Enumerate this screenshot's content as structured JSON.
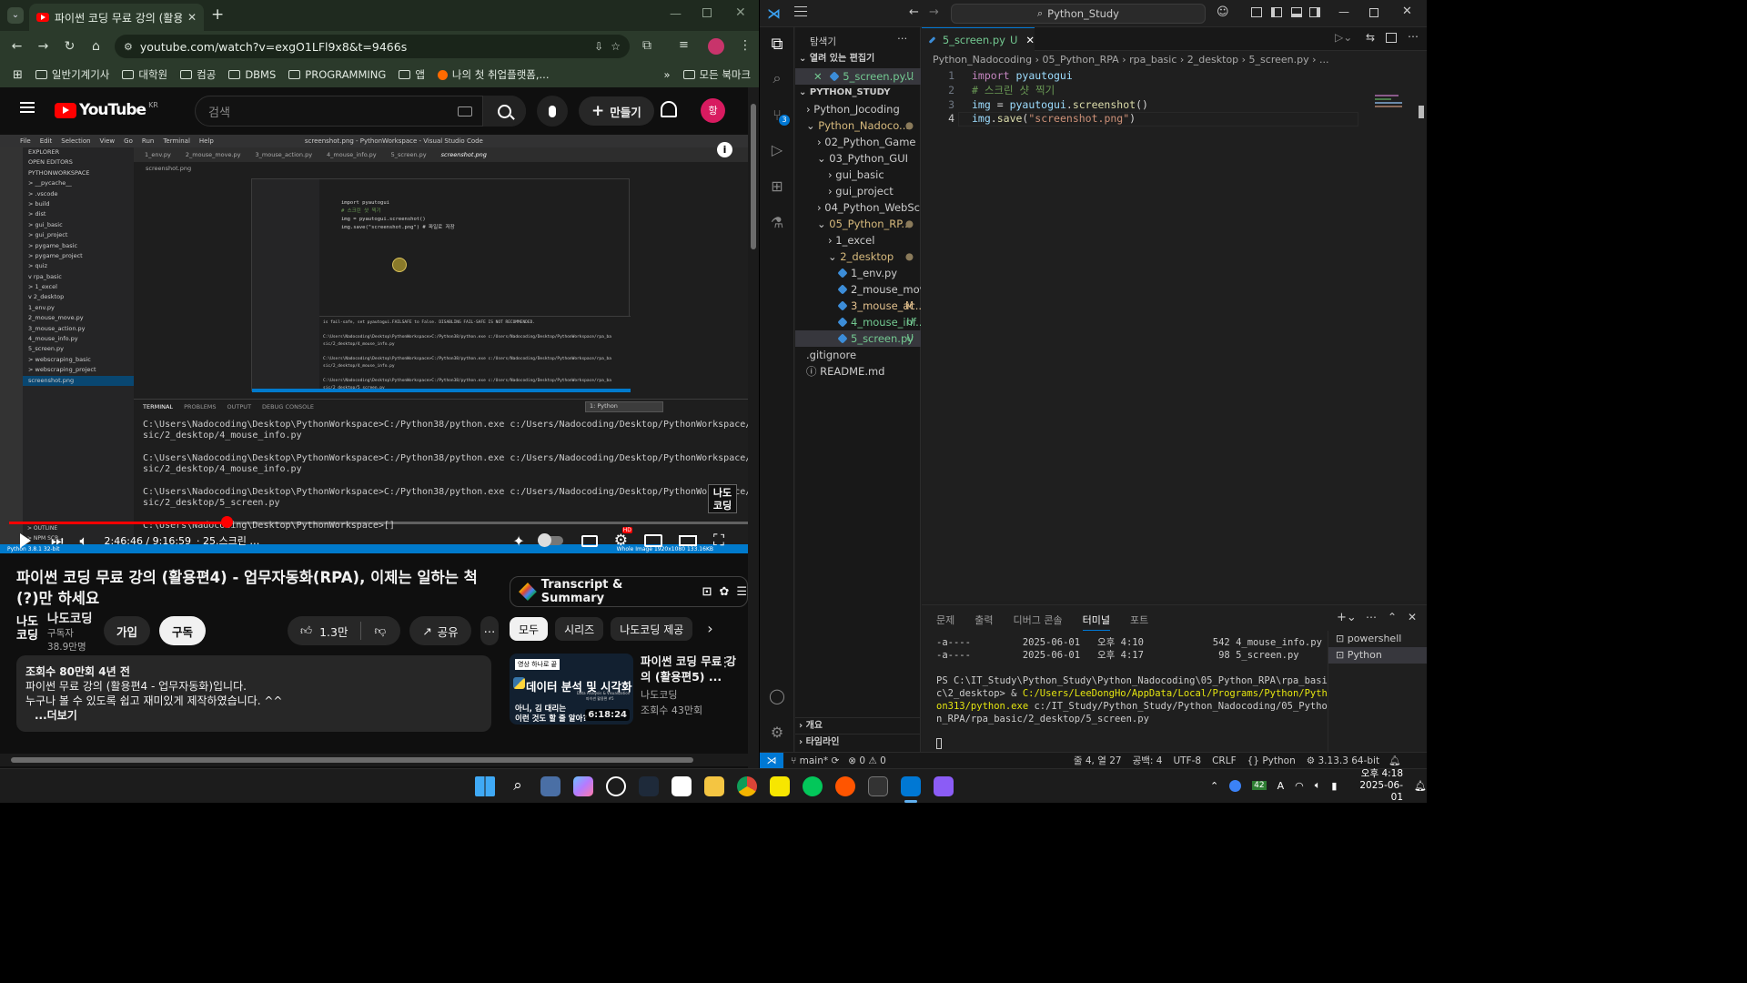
{
  "chrome": {
    "tab_title": "파이썬 코딩 무료 강의 (활용편",
    "url": "youtube.com/watch?v=exgO1LFl9x8&t=9466s",
    "bookmarks": [
      "일반기계기사",
      "대학원",
      "컴공",
      "DBMS",
      "PROGRAMMING",
      "앱",
      "나의 첫 취업플랫폼,..."
    ],
    "all_bookmarks": "모든 북마크"
  },
  "youtube": {
    "logo": "YouTube",
    "country": "KR",
    "search_placeholder": "검색",
    "create_label": "만들기",
    "avatar_initial": "항",
    "video": {
      "time": "2:46:46 / 9:16:59",
      "chapter": "· 25.스크린 …",
      "progress": 0.3,
      "watermark": "나도\n코딩",
      "hd_badge": "HD"
    },
    "title": "파이썬 코딩 무료 강의 (활용편4) - 업무자동화(RPA), 이제는 일하는 척(?)만 하세요",
    "channel_name": "나도코딩",
    "subscribers": "구독자 38.9만명",
    "channel_logo": "나도\n코딩",
    "join_label": "가입",
    "subscribe_label": "구독",
    "likes": "1.3만",
    "share_label": "공유",
    "description": {
      "stats": "조회수 80만회  4년 전",
      "line1": "파이썬 무료 강의 (활용편4 - 업무자동화)입니다.",
      "line2": "누구나 볼 수 있도록 쉽고 재미있게 제작하였습니다. ^^",
      "more": "...더보기"
    },
    "transcript_label": "Transcript & Summary",
    "chips": [
      "모두",
      "시리즈",
      "나도코딩 제공"
    ],
    "recommendation": {
      "thumb_badge": "영상 하나로 끝",
      "thumb_title": "데이터 분석 및 시각화",
      "thumb_sub1": "아니, 김 대리는",
      "thumb_sub2": "이런 것도 할 줄 알아?",
      "thumb_caption": "Data Analysis & Visualization",
      "thumb_caption2": "파이썬 활용편 #5",
      "duration": "6:18:24",
      "title": "파이썬 코딩 무료 강의 (활용편5) ...",
      "channel": "나도코딩",
      "views": "조회수 43만회"
    }
  },
  "video_frame": {
    "menu": [
      "File",
      "Edit",
      "Selection",
      "View",
      "Go",
      "Run",
      "Terminal",
      "Help"
    ],
    "window_title": "screenshot.png - PythonWorkspace - Visual Studio Code",
    "tabs": [
      "1_env.py",
      "2_mouse_move.py",
      "3_mouse_action.py",
      "4_mouse_info.py",
      "5_screen.py",
      "screenshot.png"
    ],
    "sidebar": [
      "EXPLORER",
      "OPEN EDITORS",
      "PYTHONWORKSPACE",
      "> __pycache__",
      "> .vscode",
      "> build",
      "> dist",
      "> gui_basic",
      "> gui_project",
      "> pygame_basic",
      "> pygame_project",
      "> quiz",
      "v rpa_basic",
      "  > 1_excel",
      "  v 2_desktop",
      "    1_env.py",
      "    2_mouse_move.py",
      "    3_mouse_action.py",
      "    4_mouse_info.py",
      "    5_screen.py",
      "> webscraping_basic",
      "> webscraping_project",
      "screenshot.png"
    ],
    "inner_code": [
      "import pyautogui",
      "# 스크린 샷 찍기",
      "img = pyautogui.screenshot()",
      "img.save(\"screenshot.png\") # 파일로 저장"
    ],
    "terminal_tabs": [
      "TERMINAL",
      "PROBLEMS",
      "OUTPUT",
      "DEBUG CONSOLE"
    ],
    "terminal_select": "1: Python",
    "terminal_lines": "C:\\Users\\Nadocoding\\Desktop\\PythonWorkspace>C:/Python38/python.exe c:/Users/Nadocoding/Desktop/PythonWorkspace/rpa_ba\nsic/2_desktop/4_mouse_info.py\n\nC:\\Users\\Nadocoding\\Desktop\\PythonWorkspace>C:/Python38/python.exe c:/Users/Nadocoding/Desktop/PythonWorkspace/rpa_ba\nsic/2_desktop/4_mouse_info.py\n\nC:\\Users\\Nadocoding\\Desktop\\PythonWorkspace>C:/Python38/python.exe c:/Users/Nadocoding/Desktop/PythonWorkspace/rpa_ba\nsic/2_desktop/5_screen.py\n\nC:\\Users\\Nadocoding\\Desktop\\PythonWorkspace>[]",
    "inner_terminal": "is fail-safe, set pyautogui.FAILSAFE to False. DISABLING FAIL-SAFE IS NOT RECOMMENDED.\n\nC:\\Users\\Nadocoding\\Desktop\\PythonWorkspace>C:/Python38/python.exe c:/Users/Nadocoding/Desktop/PythonWorkspace/rpa_ba\nsic/2_desktop/4_mouse_info.py\n\nC:\\Users\\Nadocoding\\Desktop\\PythonWorkspace>C:/Python38/python.exe c:/Users/Nadocoding/Desktop/PythonWorkspace/rpa_ba\nsic/2_desktop/4_mouse_info.py\n\nC:\\Users\\Nadocoding\\Desktop\\PythonWorkspace>C:/Python38/python.exe c:/Users/Nadocoding/Desktop/PythonWorkspace/rpa_ba\nsic/2_desktop/5_screen.py",
    "outline": "> OUTLINE",
    "npm": "> NPM SCR...",
    "status_left": "Python 3.8.1 32-bit",
    "status_right": "Whole Image   1920x1080   133.16KB"
  },
  "vscode": {
    "command_center": "Python_Study",
    "explorer_title": "탐색기",
    "open_editors_label": "열려 있는 편집기",
    "open_editor_file": "5_screen.py...",
    "open_editor_badge": "U",
    "workspace_label": "PYTHON_STUDY",
    "tree": [
      {
        "label": "Python_Jocoding",
        "indent": 1,
        "kind": "folder-closed",
        "badge": "",
        "color": "#cccccc"
      },
      {
        "label": "Python_Nadoco...",
        "indent": 1,
        "kind": "folder-open",
        "badge": "●",
        "color": "#d7ba7d"
      },
      {
        "label": "02_Python_Game",
        "indent": 2,
        "kind": "folder-closed",
        "badge": "",
        "color": "#cccccc"
      },
      {
        "label": "03_Python_GUI",
        "indent": 2,
        "kind": "folder-open",
        "badge": "",
        "color": "#cccccc"
      },
      {
        "label": "gui_basic",
        "indent": 3,
        "kind": "folder-closed",
        "badge": "",
        "color": "#cccccc"
      },
      {
        "label": "gui_project",
        "indent": 3,
        "kind": "folder-closed",
        "badge": "",
        "color": "#cccccc"
      },
      {
        "label": "04_Python_WebScra...",
        "indent": 2,
        "kind": "folder-closed",
        "badge": "",
        "color": "#cccccc"
      },
      {
        "label": "05_Python_RP...",
        "indent": 2,
        "kind": "folder-open",
        "badge": "●",
        "color": "#d7ba7d"
      },
      {
        "label": "1_excel",
        "indent": 3,
        "kind": "folder-closed",
        "badge": "",
        "color": "#cccccc"
      },
      {
        "label": "2_desktop",
        "indent": 3,
        "kind": "folder-open",
        "badge": "●",
        "color": "#d7ba7d"
      },
      {
        "label": "1_env.py",
        "indent": 4,
        "kind": "py",
        "badge": "",
        "color": "#cccccc"
      },
      {
        "label": "2_mouse_move.py",
        "indent": 4,
        "kind": "py",
        "badge": "",
        "color": "#cccccc"
      },
      {
        "label": "3_mouse_ac...",
        "indent": 4,
        "kind": "py",
        "badge": "M",
        "color": "#e2c08d"
      },
      {
        "label": "4_mouse_inf...",
        "indent": 4,
        "kind": "py",
        "badge": "U",
        "color": "#73c991"
      },
      {
        "label": "5_screen.py",
        "indent": 4,
        "kind": "py",
        "badge": "U",
        "color": "#73c991"
      },
      {
        "label": ".gitignore",
        "indent": 1,
        "kind": "file",
        "badge": "",
        "color": "#cccccc"
      },
      {
        "label": "README.md",
        "indent": 1,
        "kind": "info",
        "badge": "",
        "color": "#cccccc"
      }
    ],
    "outline_label": "개요",
    "timeline_label": "타임라인",
    "tab_label": "5_screen.py",
    "tab_badge": "U",
    "breadcrumb": "Python_Nadocoding › 05_Python_RPA › rpa_basic › 2_desktop › 5_screen.py › ...",
    "code_lines": [
      [
        {
          "t": "import ",
          "c": "kw"
        },
        {
          "t": "pyautogui",
          "c": "var"
        }
      ],
      [
        {
          "t": "# 스크린 샷 찍기",
          "c": "cmt"
        }
      ],
      [
        {
          "t": "img",
          "c": "var"
        },
        {
          "t": " = ",
          "c": "pl"
        },
        {
          "t": "pyautogui",
          "c": "var"
        },
        {
          "t": ".",
          "c": "pl"
        },
        {
          "t": "screenshot",
          "c": "fn"
        },
        {
          "t": "()",
          "c": "pl"
        }
      ],
      [
        {
          "t": "img",
          "c": "var"
        },
        {
          "t": ".",
          "c": "pl"
        },
        {
          "t": "save",
          "c": "fn"
        },
        {
          "t": "(",
          "c": "pl"
        },
        {
          "t": "\"screenshot.png\"",
          "c": "str"
        },
        {
          "t": ")",
          "c": "pl"
        }
      ]
    ],
    "panel_tabs": [
      "문제",
      "출력",
      "디버그 콘솔",
      "터미널",
      "포트"
    ],
    "terminal": [
      {
        "text": "-a----         2025-06-01   오후 4:10            542 4_mouse_info.py",
        "color": "#cccccc"
      },
      {
        "text": "-a----         2025-06-01   오후 4:17             98 5_screen.py",
        "color": "#cccccc"
      },
      {
        "text": "",
        "color": "#cccccc"
      },
      {
        "text": "PS C:\\IT_Study\\Python_Study\\Python_Nadocoding\\05_Python_RPA\\rpa_basic\\2_desktop> & ",
        "color": "#cccccc",
        "hl": "C:/Users/LeeDongHo/AppData/Local/Programs/Python/Python313/python.exe",
        "rest": " c:/IT_Study/Python_Study/Python_Nadocoding/05_Python_RPA/rpa_basic/2_desktop/5_screen.py"
      }
    ],
    "terminal_sessions": [
      "powershell",
      "Python"
    ],
    "status": {
      "branch": "main*",
      "problems": "⊗ 0 ⚠ 0",
      "position": "줄 4, 열 27",
      "spaces": "공백: 4",
      "encoding": "UTF-8",
      "eol": "CRLF",
      "language": "Python",
      "interpreter": "3.13.3 64-bit"
    },
    "scm_badge": "3"
  },
  "taskbar": {
    "tray_badge": "42",
    "ime": "A",
    "time": "오후 4:18",
    "date": "2025-06-01"
  },
  "colors": {
    "yt_red": "#ff0000",
    "vscode_blue": "#0078d4",
    "chrome_green": "#2b3a2b"
  }
}
